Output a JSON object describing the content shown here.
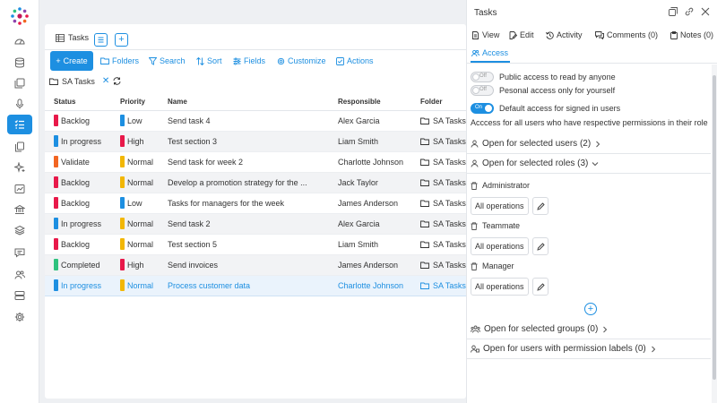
{
  "main": {
    "tab_label": "Tasks",
    "toolbar": {
      "create": "Create",
      "folders": "Folders",
      "search": "Search",
      "sort": "Sort",
      "fields": "Fields",
      "customize": "Customize",
      "actions": "Actions"
    },
    "filter_label": "SA Tasks",
    "columns": [
      "Status",
      "Priority",
      "Name",
      "Responsible",
      "Folder"
    ],
    "rows": [
      {
        "status": "Backlog",
        "status_color": "#e8194a",
        "priority": "Low",
        "priority_color": "#1d8fe1",
        "name": "Send task 4",
        "responsible": "Alex Garcia",
        "folder": "SA Tasks"
      },
      {
        "status": "In progress",
        "status_color": "#1d8fe1",
        "priority": "High",
        "priority_color": "#e8194a",
        "name": "Test section 3",
        "responsible": "Liam Smith",
        "folder": "SA Tasks"
      },
      {
        "status": "Validate",
        "status_color": "#f26522",
        "priority": "Normal",
        "priority_color": "#f2b705",
        "name": "Send task for week 2",
        "responsible": "Charlotte Johnson",
        "folder": "SA Tasks"
      },
      {
        "status": "Backlog",
        "status_color": "#e8194a",
        "priority": "Normal",
        "priority_color": "#f2b705",
        "name": "Develop a promotion strategy for the ...",
        "responsible": "Jack Taylor",
        "folder": "SA Tasks"
      },
      {
        "status": "Backlog",
        "status_color": "#e8194a",
        "priority": "Low",
        "priority_color": "#1d8fe1",
        "name": "Tasks for managers for the week",
        "responsible": "James Anderson",
        "folder": "SA Tasks"
      },
      {
        "status": "In progress",
        "status_color": "#1d8fe1",
        "priority": "Normal",
        "priority_color": "#f2b705",
        "name": "Send task 2",
        "responsible": "Alex Garcia",
        "folder": "SA Tasks"
      },
      {
        "status": "Backlog",
        "status_color": "#e8194a",
        "priority": "Normal",
        "priority_color": "#f2b705",
        "name": "Test section 5",
        "responsible": "Liam Smith",
        "folder": "SA Tasks"
      },
      {
        "status": "Completed",
        "status_color": "#2ec27e",
        "priority": "High",
        "priority_color": "#e8194a",
        "name": "Send invoices",
        "responsible": "James Anderson",
        "folder": "SA Tasks"
      },
      {
        "status": "In progress",
        "status_color": "#1d8fe1",
        "priority": "Normal",
        "priority_color": "#f2b705",
        "name": "Process customer data",
        "responsible": "Charlotte Johnson",
        "folder": "SA Tasks"
      }
    ]
  },
  "panel": {
    "title": "Tasks",
    "tabs": {
      "view": "View",
      "edit": "Edit",
      "activity": "Activity",
      "comments": "Comments (0)",
      "notes": "Notes (0)",
      "access": "Access"
    },
    "public_access": {
      "state": "Off",
      "label": "Public access to read by anyone"
    },
    "personal_access": {
      "state": "Off",
      "label": "Pesonal access only for yourself"
    },
    "default_access": {
      "state": "On",
      "label": "Default access for signed in users"
    },
    "default_desc": "Accсess for all users who have respective permissions in their role",
    "sections": {
      "users": "Open for selected users (2)",
      "roles": "Open for selected roles (3)",
      "groups": "Open for selected groups (0)",
      "labels": "Open for users with permission labels (0)"
    },
    "roles": [
      {
        "name": "Administrator",
        "ops": "All operations"
      },
      {
        "name": "Teammate",
        "ops": "All operations"
      },
      {
        "name": "Manager",
        "ops": "All operations"
      }
    ]
  },
  "colors": {
    "accent": "#1d8fe1",
    "selected_row": "#eaf3fc"
  }
}
